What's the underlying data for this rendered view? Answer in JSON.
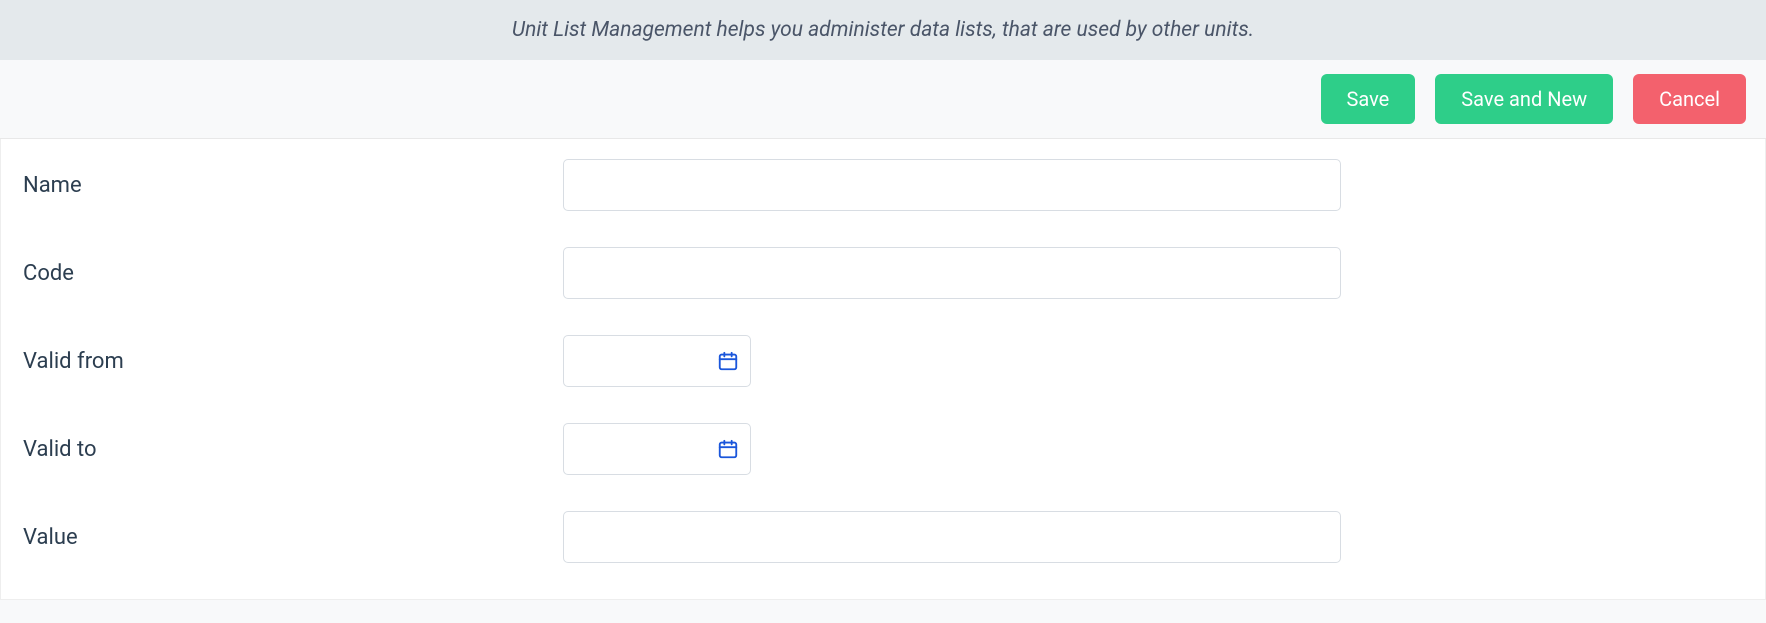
{
  "banner": {
    "text": "Unit List Management helps you administer data lists, that are used by other units."
  },
  "toolbar": {
    "save_label": "Save",
    "save_and_new_label": "Save and New",
    "cancel_label": "Cancel"
  },
  "form": {
    "name": {
      "label": "Name",
      "value": ""
    },
    "code": {
      "label": "Code",
      "value": ""
    },
    "valid_from": {
      "label": "Valid from",
      "value": ""
    },
    "valid_to": {
      "label": "Valid to",
      "value": ""
    },
    "value": {
      "label": "Value",
      "value": ""
    }
  }
}
